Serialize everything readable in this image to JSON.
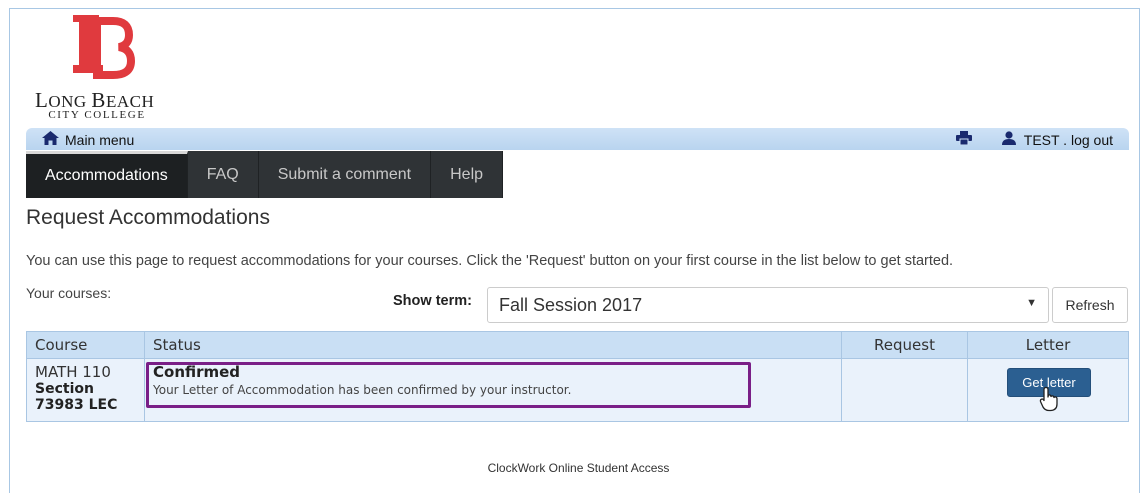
{
  "logo": {
    "letters": "LB",
    "name_first_cap": "L",
    "name_first_rest": "ONG ",
    "name_second_cap": "B",
    "name_second_rest": "EACH",
    "subtitle": "CITY COLLEGE",
    "color": "#e03a3e"
  },
  "menubar": {
    "main_menu_label": "Main menu",
    "print_icon": "printer-icon",
    "user_icon": "user-icon",
    "user_text": "TEST . log out"
  },
  "nav": {
    "tabs": [
      {
        "label": "Accommodations",
        "active": true
      },
      {
        "label": "FAQ"
      },
      {
        "label": "Submit a comment"
      },
      {
        "label": "Help"
      }
    ]
  },
  "page": {
    "title": "Request Accommodations",
    "intro": "You can use this page to request accommodations for your courses. Click the 'Request' button on your first course in the list below to get started.",
    "courses_label": "Your courses:"
  },
  "term": {
    "label": "Show term:",
    "selected": "Fall Session 2017",
    "refresh_label": "Refresh"
  },
  "table": {
    "headers": {
      "course": "Course",
      "status": "Status",
      "request": "Request",
      "letter": "Letter"
    },
    "rows": [
      {
        "course_code": "MATH 110",
        "section_label": "Section",
        "section_number": "73983 LEC",
        "status_title": "Confirmed",
        "status_desc": "Your Letter of Accommodation has been confirmed by your instructor.",
        "request": "",
        "letter_button": "Get letter"
      }
    ]
  },
  "colors": {
    "highlight": "#7a1f87",
    "header_bg": "#c9dff4",
    "button_bg": "#2b5f91",
    "nav_bg": "#2f3336"
  },
  "footer": {
    "text": "ClockWork Online Student Access"
  }
}
